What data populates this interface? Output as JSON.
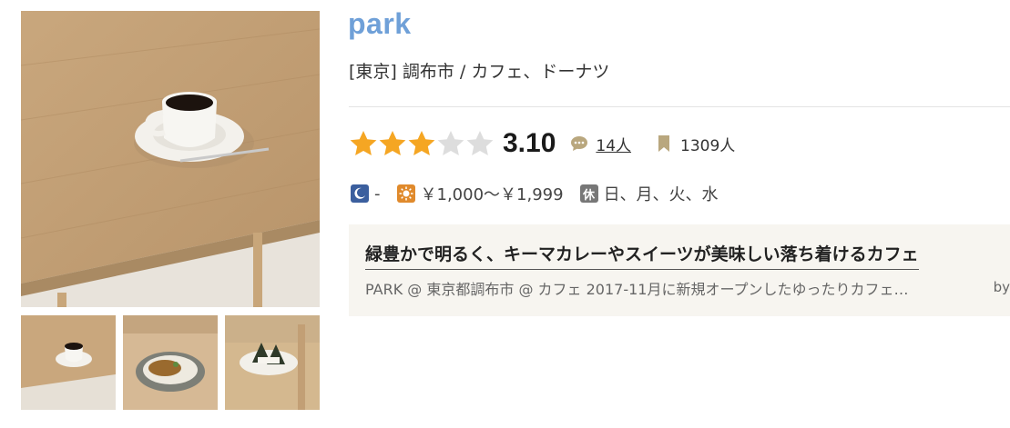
{
  "restaurant": {
    "name": "park",
    "area_genre": "[東京] 調布市 / カフェ、ドーナツ"
  },
  "rating": {
    "score": "3.10",
    "value": 3.1,
    "max": 5,
    "reviews": "14人",
    "bookmarks": "1309人",
    "star_color": "#f5a623",
    "star_empty_color": "#dddddd"
  },
  "info": {
    "dinner_budget": "-",
    "lunch_budget": "￥1,000～￥1,999",
    "holiday_label": "休",
    "holidays": "日、月、火、水"
  },
  "feature": {
    "headline": "緑豊かで明るく、キーマカレーやスイーツが美味しい落ち着けるカフェ",
    "body": "PARK @ 東京都調布市 @ カフェ 2017-11月に新規オープンしたゆったりカフェ…",
    "by": "by"
  },
  "photos": {
    "main": "coffee cup on wooden table",
    "thumbnails": [
      "coffee cup on wooden table",
      "keema curry plate",
      "onigiri on plate"
    ]
  },
  "colors": {
    "title": "#6fa0d8",
    "feature_bg": "#f7f5f0"
  }
}
